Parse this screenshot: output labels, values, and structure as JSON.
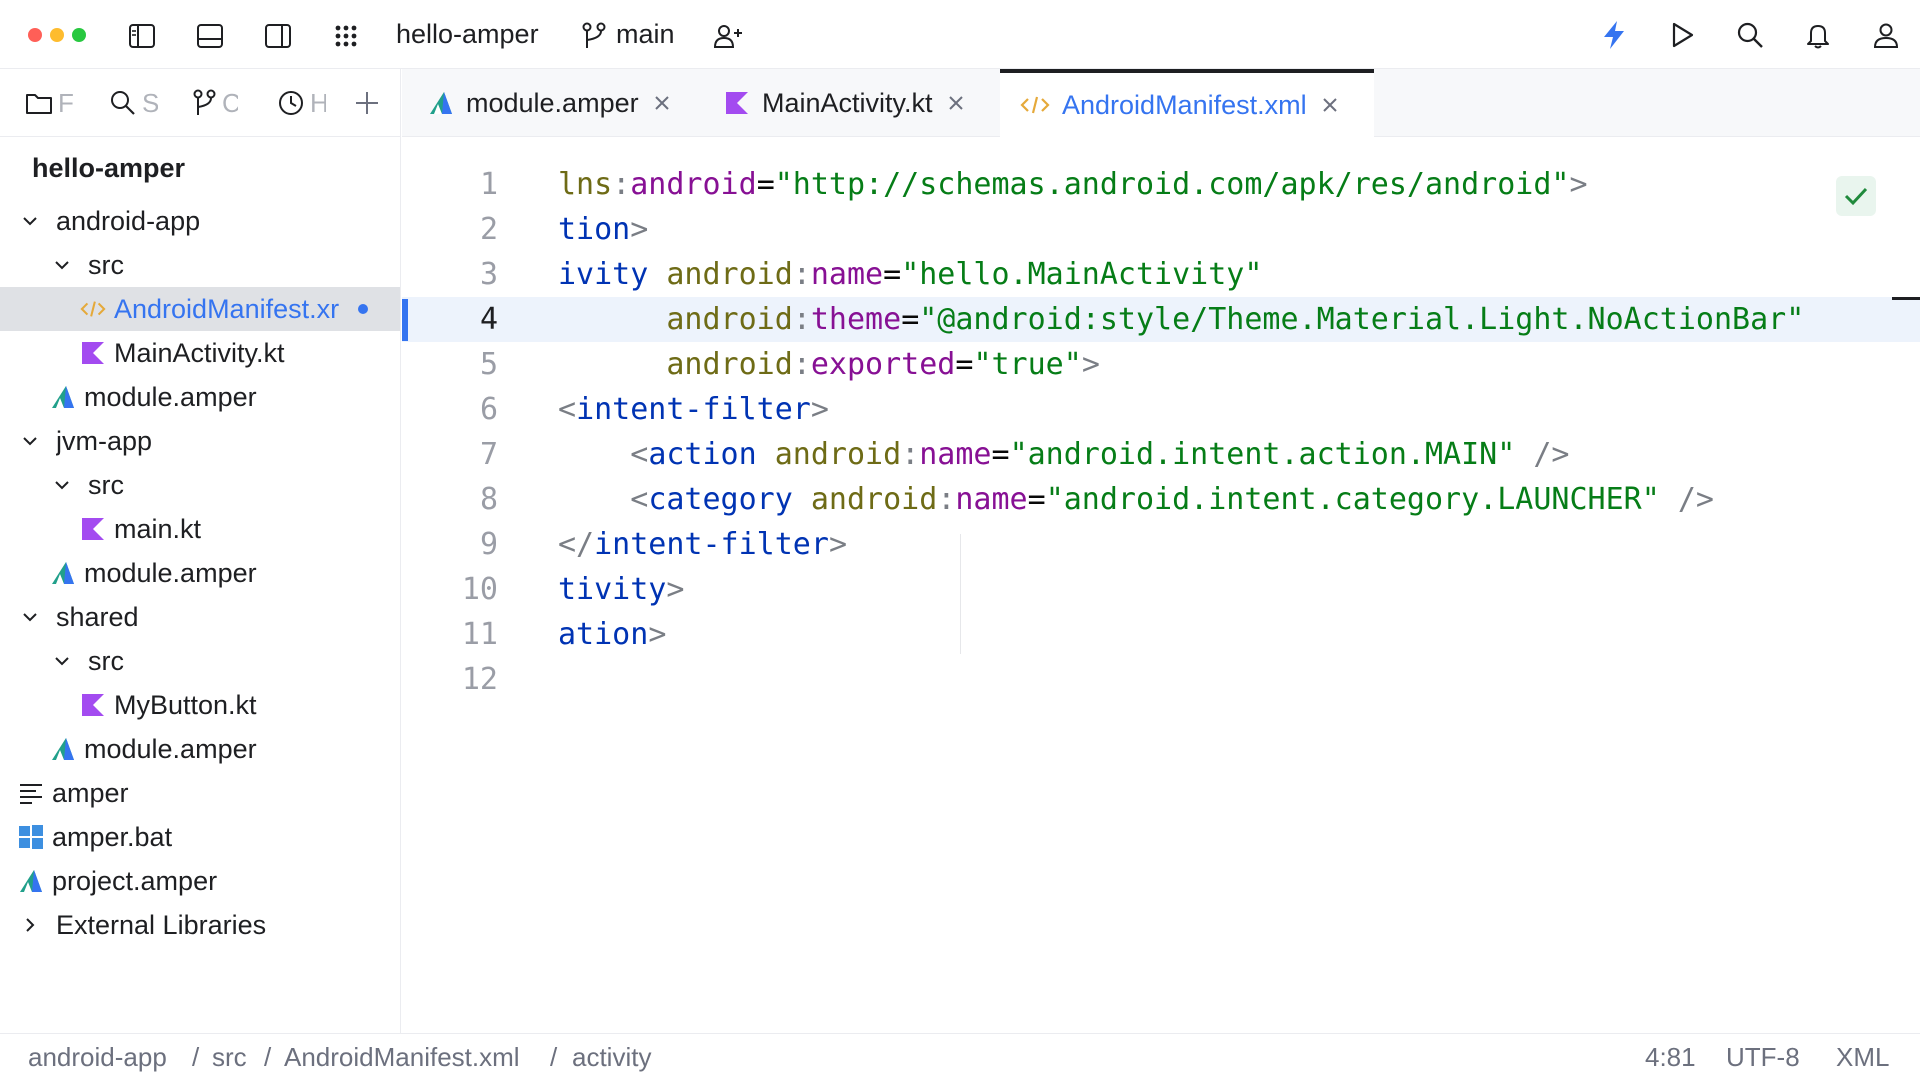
{
  "toolbar": {
    "project_name": "hello-amper",
    "branch": "main",
    "colors": {
      "accent": "#3574f0",
      "close_dot": "#ff5f57",
      "min_dot": "#febc2e",
      "max_dot": "#28c840"
    }
  },
  "sidebar": {
    "tabs": [
      {
        "icon": "folder-icon",
        "label": "F"
      },
      {
        "icon": "search-icon",
        "label": "S"
      },
      {
        "icon": "git-branch-icon",
        "label": "C"
      },
      {
        "icon": "clock-icon",
        "label": "H"
      },
      {
        "icon": "plus-icon",
        "label": ""
      }
    ],
    "root": "hello-amper",
    "tree": [
      {
        "label": "android-app",
        "icon": "",
        "expanded": true
      },
      {
        "label": "src",
        "icon": "",
        "expanded": true
      },
      {
        "label": "AndroidManifest.xr",
        "icon": "xml-file-icon",
        "selected": true,
        "modified": true
      },
      {
        "label": "MainActivity.kt",
        "icon": "kotlin-file-icon"
      },
      {
        "label": "module.amper",
        "icon": "amper-file-icon"
      },
      {
        "label": "jvm-app",
        "icon": "",
        "expanded": true
      },
      {
        "label": "src",
        "icon": "",
        "expanded": true
      },
      {
        "label": "main.kt",
        "icon": "kotlin-file-icon"
      },
      {
        "label": "module.amper",
        "icon": "amper-file-icon"
      },
      {
        "label": "shared",
        "icon": "",
        "expanded": true
      },
      {
        "label": "src",
        "icon": "",
        "expanded": true
      },
      {
        "label": "MyButton.kt",
        "icon": "kotlin-file-icon"
      },
      {
        "label": "module.amper",
        "icon": "amper-file-icon"
      },
      {
        "label": "amper",
        "icon": "text-file-icon"
      },
      {
        "label": "amper.bat",
        "icon": "windows-file-icon"
      },
      {
        "label": "project.amper",
        "icon": "amper-file-icon"
      },
      {
        "label": "External Libraries",
        "icon": "",
        "expanded": false
      }
    ]
  },
  "editor_tabs": [
    {
      "label": "module.amper",
      "icon": "amper-file-icon",
      "active": false
    },
    {
      "label": "MainActivity.kt",
      "icon": "kotlin-file-icon",
      "active": false
    },
    {
      "label": "AndroidManifest.xml",
      "icon": "xml-file-icon",
      "active": true
    }
  ],
  "editor": {
    "line_numbers": [
      "1",
      "2",
      "3",
      "4",
      "5",
      "6",
      "7",
      "8",
      "9",
      "10",
      "11",
      "12"
    ],
    "current_line": 4,
    "code": {
      "l1": {
        "t1": "lns",
        "t2": ":",
        "t3": "android",
        "t4": "=",
        "t5": "\"http://schemas.android.com/apk/res/android\"",
        "t6": ">"
      },
      "l2": {
        "t1": "tion",
        "t2": ">"
      },
      "l3": {
        "t1": "ivity ",
        "t2": "android",
        "t3": ":",
        "t4": "name",
        "t5": "=",
        "t6": "\"hello.MainActivity\""
      },
      "l4": {
        "t0": "      ",
        "t1": "android",
        "t2": ":",
        "t3": "theme",
        "t4": "=",
        "t5": "\"@android:style/Theme.Material.Light.NoActionBar\""
      },
      "l5": {
        "t0": "      ",
        "t1": "android",
        "t2": ":",
        "t3": "exported",
        "t4": "=",
        "t5": "\"true\"",
        "t6": ">"
      },
      "l6": {
        "t1": "<",
        "t2": "intent-filter",
        "t3": ">"
      },
      "l7": {
        "t0": "    ",
        "t1": "<",
        "t2": "action ",
        "t3": "android",
        "t4": ":",
        "t5": "name",
        "t6": "=",
        "t7": "\"android.intent.action.MAIN\"",
        "t8": " />"
      },
      "l8": {
        "t0": "    ",
        "t1": "<",
        "t2": "category ",
        "t3": "android",
        "t4": ":",
        "t5": "name",
        "t6": "=",
        "t7": "\"android.intent.category.LAUNCHER\"",
        "t8": " />"
      },
      "l9": {
        "t1": "</",
        "t2": "intent-filter",
        "t3": ">"
      },
      "l10": {
        "t1": "tivity",
        "t2": ">"
      },
      "l11": {
        "t1": "ation",
        "t2": ">"
      },
      "l12": {}
    }
  },
  "statusbar": {
    "breadcrumbs": [
      "android-app",
      "src",
      "AndroidManifest.xml",
      "activity"
    ],
    "separator": "/",
    "cursor": "4:81",
    "encoding": "UTF-8",
    "language": "XML"
  }
}
